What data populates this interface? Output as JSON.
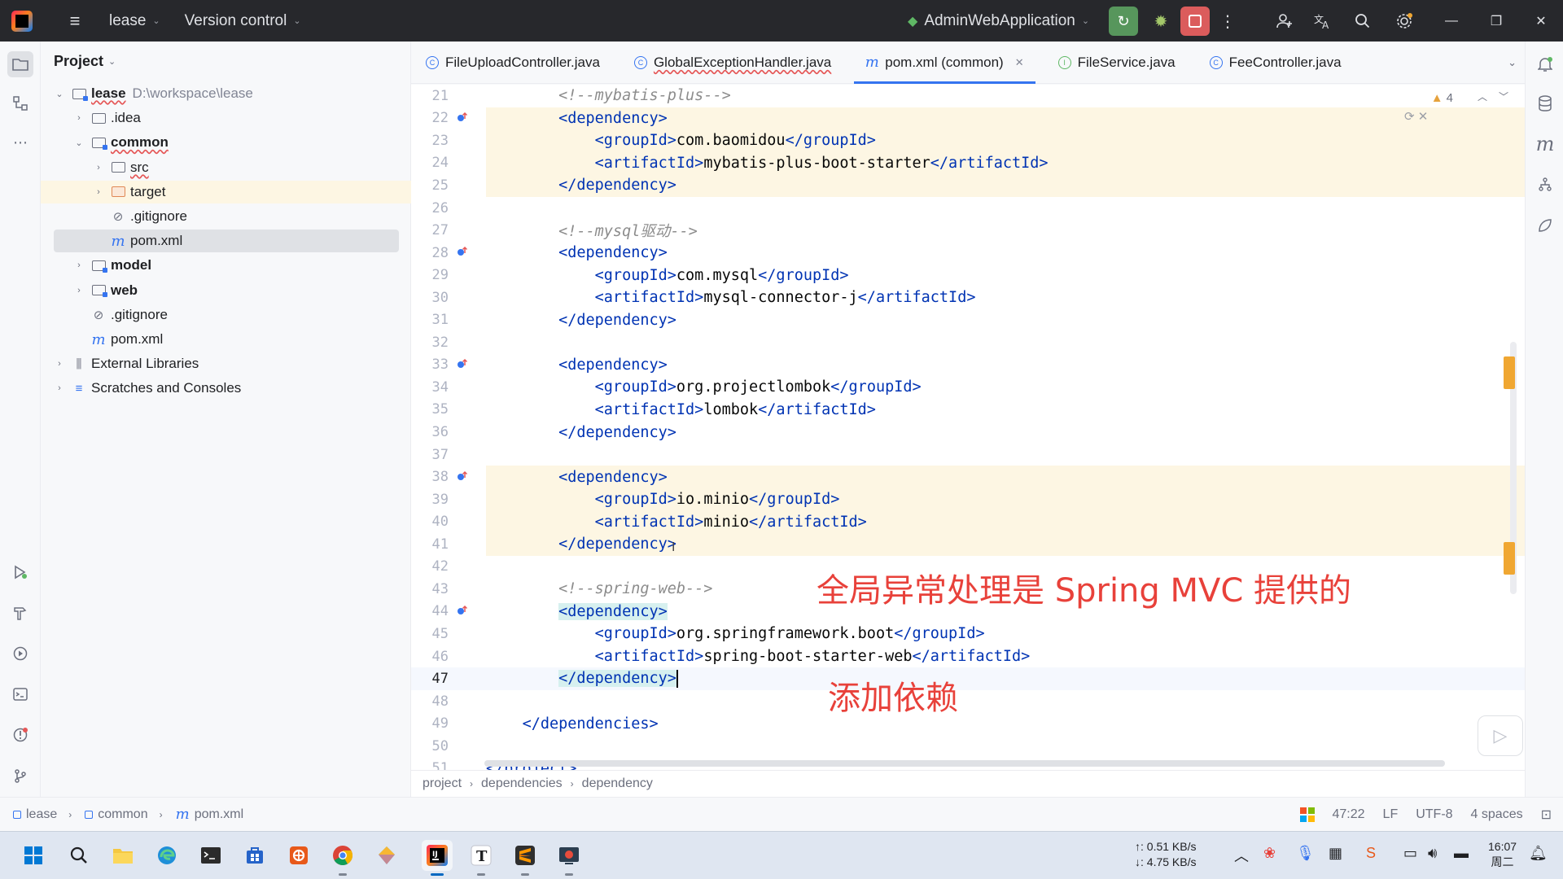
{
  "titlebar": {
    "project_name": "lease",
    "version_control": "Version control",
    "run_config": "AdminWebApplication"
  },
  "project_panel": {
    "title": "Project",
    "tree": [
      {
        "label": "lease",
        "path": "D:\\workspace\\lease",
        "depth": 0,
        "arrow": "down",
        "icon": "module-folder",
        "bold": true,
        "underline": true
      },
      {
        "label": ".idea",
        "depth": 1,
        "arrow": "right",
        "icon": "folder"
      },
      {
        "label": "common",
        "depth": 1,
        "arrow": "down",
        "icon": "module-folder",
        "bold": true,
        "underline": true
      },
      {
        "label": "src",
        "depth": 2,
        "arrow": "right",
        "icon": "folder",
        "underline": true
      },
      {
        "label": "target",
        "depth": 2,
        "arrow": "right",
        "icon": "orange-folder",
        "highlight": "yellow"
      },
      {
        "label": ".gitignore",
        "depth": 2,
        "arrow": "",
        "icon": "ignore"
      },
      {
        "label": "pom.xml",
        "depth": 2,
        "arrow": "",
        "icon": "maven",
        "highlight": "selected"
      },
      {
        "label": "model",
        "depth": 1,
        "arrow": "right",
        "icon": "module-folder",
        "bold": true
      },
      {
        "label": "web",
        "depth": 1,
        "arrow": "right",
        "icon": "module-folder",
        "bold": true
      },
      {
        "label": ".gitignore",
        "depth": 1,
        "arrow": "",
        "icon": "ignore"
      },
      {
        "label": "pom.xml",
        "depth": 1,
        "arrow": "",
        "icon": "maven"
      },
      {
        "label": "External Libraries",
        "depth": 0,
        "arrow": "right",
        "icon": "library"
      },
      {
        "label": "Scratches and Consoles",
        "depth": 0,
        "arrow": "right",
        "icon": "scratch"
      }
    ]
  },
  "tabs": [
    {
      "label": "FileUploadController.java",
      "icon": "class"
    },
    {
      "label": "GlobalExceptionHandler.java",
      "icon": "class",
      "underline": true
    },
    {
      "label": "pom.xml (common)",
      "icon": "maven",
      "active": true,
      "closable": true
    },
    {
      "label": "FileService.java",
      "icon": "interface"
    },
    {
      "label": "FeeController.java",
      "icon": "class"
    }
  ],
  "editor": {
    "warning_count": "4",
    "lines": [
      {
        "n": "21",
        "parts": [
          [
            "cmt",
            "        <!--mybatis-plus-->"
          ]
        ]
      },
      {
        "n": "22",
        "mark": true,
        "parts": [
          [
            "txt",
            "        "
          ],
          [
            "tag",
            "<dependency>"
          ]
        ]
      },
      {
        "n": "23",
        "parts": [
          [
            "txt",
            "            "
          ],
          [
            "tag",
            "<groupId>"
          ],
          [
            "txt",
            "com.baomidou"
          ],
          [
            "tag",
            "</groupId>"
          ]
        ]
      },
      {
        "n": "24",
        "parts": [
          [
            "txt",
            "            "
          ],
          [
            "tag",
            "<artifactId>"
          ],
          [
            "txt",
            "mybatis-plus-boot-starter"
          ],
          [
            "tag",
            "</artifactId>"
          ]
        ]
      },
      {
        "n": "25",
        "parts": [
          [
            "txt",
            "        "
          ],
          [
            "tag",
            "</dependency>"
          ]
        ]
      },
      {
        "n": "26",
        "parts": []
      },
      {
        "n": "27",
        "parts": [
          [
            "cmt",
            "        <!--mysql驱动-->"
          ]
        ]
      },
      {
        "n": "28",
        "mark": true,
        "parts": [
          [
            "txt",
            "        "
          ],
          [
            "tag",
            "<dependency>"
          ]
        ]
      },
      {
        "n": "29",
        "parts": [
          [
            "txt",
            "            "
          ],
          [
            "tag",
            "<groupId>"
          ],
          [
            "txt",
            "com.mysql"
          ],
          [
            "tag",
            "</groupId>"
          ]
        ]
      },
      {
        "n": "30",
        "parts": [
          [
            "txt",
            "            "
          ],
          [
            "tag",
            "<artifactId>"
          ],
          [
            "txt",
            "mysql-connector-j"
          ],
          [
            "tag",
            "</artifactId>"
          ]
        ]
      },
      {
        "n": "31",
        "parts": [
          [
            "txt",
            "        "
          ],
          [
            "tag",
            "</dependency>"
          ]
        ]
      },
      {
        "n": "32",
        "parts": []
      },
      {
        "n": "33",
        "mark": true,
        "parts": [
          [
            "txt",
            "        "
          ],
          [
            "tag",
            "<dependency>"
          ]
        ]
      },
      {
        "n": "34",
        "parts": [
          [
            "txt",
            "            "
          ],
          [
            "tag",
            "<groupId>"
          ],
          [
            "txt",
            "org.projectlombok"
          ],
          [
            "tag",
            "</groupId>"
          ]
        ]
      },
      {
        "n": "35",
        "parts": [
          [
            "txt",
            "            "
          ],
          [
            "tag",
            "<artifactId>"
          ],
          [
            "txt",
            "lombok"
          ],
          [
            "tag",
            "</artifactId>"
          ]
        ]
      },
      {
        "n": "36",
        "parts": [
          [
            "txt",
            "        "
          ],
          [
            "tag",
            "</dependency>"
          ]
        ]
      },
      {
        "n": "37",
        "parts": []
      },
      {
        "n": "38",
        "mark": true,
        "parts": [
          [
            "txt",
            "        "
          ],
          [
            "tag",
            "<dependency>"
          ]
        ]
      },
      {
        "n": "39",
        "parts": [
          [
            "txt",
            "            "
          ],
          [
            "tag",
            "<groupId>"
          ],
          [
            "txt",
            "io.minio"
          ],
          [
            "tag",
            "</groupId>"
          ]
        ]
      },
      {
        "n": "40",
        "parts": [
          [
            "txt",
            "            "
          ],
          [
            "tag",
            "<artifactId>"
          ],
          [
            "txt",
            "minio"
          ],
          [
            "tag",
            "</artifactId>"
          ]
        ]
      },
      {
        "n": "41",
        "parts": [
          [
            "txt",
            "        "
          ],
          [
            "tag",
            "</dependency>"
          ]
        ]
      },
      {
        "n": "42",
        "parts": []
      },
      {
        "n": "43",
        "parts": [
          [
            "cmt",
            "        <!--spring-web-->"
          ]
        ]
      },
      {
        "n": "44",
        "mark": true,
        "parts": [
          [
            "txt",
            "        "
          ],
          [
            "tag-hl",
            "<dependency>"
          ]
        ]
      },
      {
        "n": "45",
        "parts": [
          [
            "txt",
            "            "
          ],
          [
            "tag",
            "<groupId>"
          ],
          [
            "txt",
            "org.springframework.boot"
          ],
          [
            "tag",
            "</groupId>"
          ]
        ]
      },
      {
        "n": "46",
        "parts": [
          [
            "txt",
            "            "
          ],
          [
            "tag",
            "<artifactId>"
          ],
          [
            "txt",
            "spring-boot-starter-web"
          ],
          [
            "tag",
            "</artifactId>"
          ]
        ]
      },
      {
        "n": "47",
        "current": true,
        "parts": [
          [
            "txt",
            "        "
          ],
          [
            "tag-hl",
            "</dependency>"
          ],
          [
            "caret",
            ""
          ]
        ]
      },
      {
        "n": "48",
        "parts": []
      },
      {
        "n": "49",
        "parts": [
          [
            "txt",
            "    "
          ],
          [
            "tag",
            "</dependencies>"
          ]
        ]
      },
      {
        "n": "50",
        "parts": []
      },
      {
        "n": "51",
        "parts": [
          [
            "tag",
            "</project>"
          ]
        ]
      }
    ],
    "overlay_1": "全局异常处理是 Spring MVC 提供的",
    "overlay_2": "添加依赖"
  },
  "editor_breadcrumb": [
    "project",
    "dependencies",
    "dependency"
  ],
  "statusbar": {
    "crumbs": [
      "lease",
      "common",
      "pom.xml"
    ],
    "position": "47:22",
    "line_sep": "LF",
    "encoding": "UTF-8",
    "indent": "4 spaces"
  },
  "taskbar": {
    "upload": "↑: 0.51 KB/s",
    "download": "↓: 4.75 KB/s",
    "time": "16:07",
    "day": "周二"
  }
}
